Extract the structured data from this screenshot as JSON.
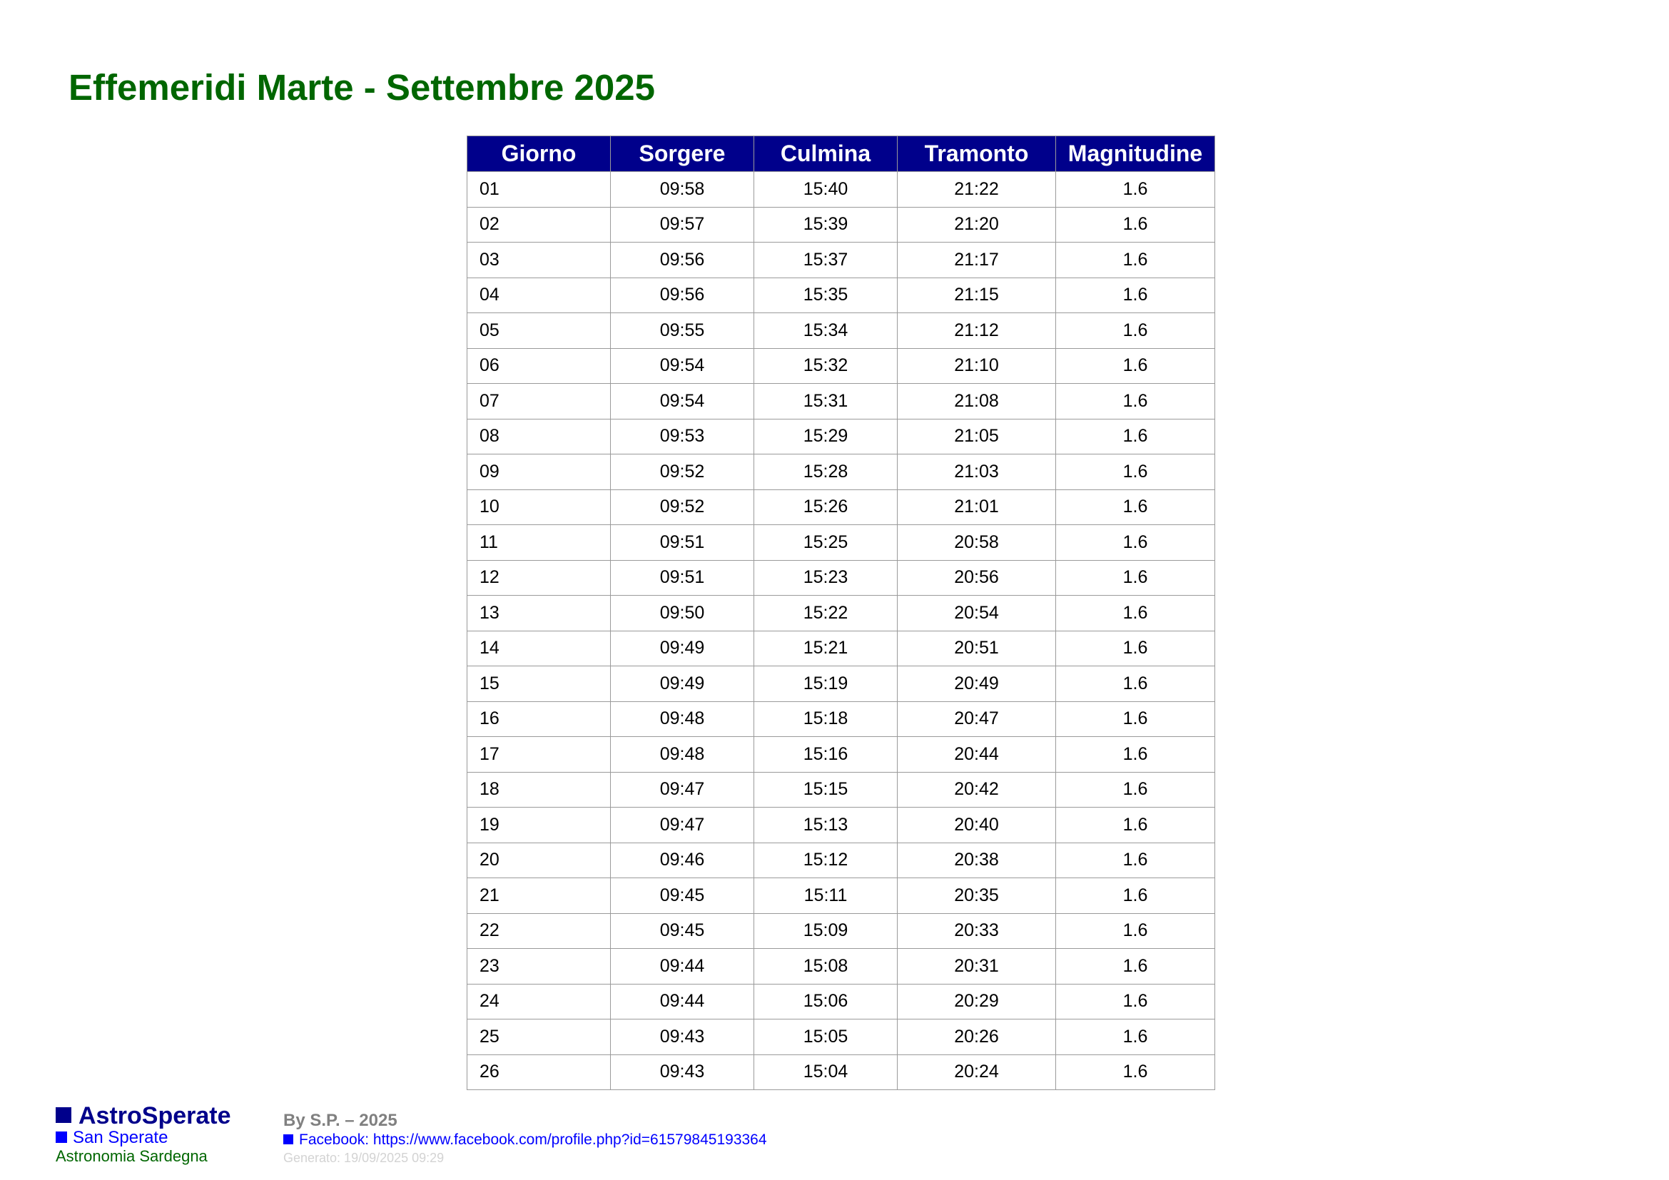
{
  "page": {
    "title": "Effemeridi Marte - Settembre 2025"
  },
  "table": {
    "columns": [
      "Giorno",
      "Sorgere",
      "Culmina",
      "Tramonto",
      "Magnitudine"
    ],
    "rows": [
      [
        "01",
        "09:58",
        "15:40",
        "21:22",
        "1.6"
      ],
      [
        "02",
        "09:57",
        "15:39",
        "21:20",
        "1.6"
      ],
      [
        "03",
        "09:56",
        "15:37",
        "21:17",
        "1.6"
      ],
      [
        "04",
        "09:56",
        "15:35",
        "21:15",
        "1.6"
      ],
      [
        "05",
        "09:55",
        "15:34",
        "21:12",
        "1.6"
      ],
      [
        "06",
        "09:54",
        "15:32",
        "21:10",
        "1.6"
      ],
      [
        "07",
        "09:54",
        "15:31",
        "21:08",
        "1.6"
      ],
      [
        "08",
        "09:53",
        "15:29",
        "21:05",
        "1.6"
      ],
      [
        "09",
        "09:52",
        "15:28",
        "21:03",
        "1.6"
      ],
      [
        "10",
        "09:52",
        "15:26",
        "21:01",
        "1.6"
      ],
      [
        "11",
        "09:51",
        "15:25",
        "20:58",
        "1.6"
      ],
      [
        "12",
        "09:51",
        "15:23",
        "20:56",
        "1.6"
      ],
      [
        "13",
        "09:50",
        "15:22",
        "20:54",
        "1.6"
      ],
      [
        "14",
        "09:49",
        "15:21",
        "20:51",
        "1.6"
      ],
      [
        "15",
        "09:49",
        "15:19",
        "20:49",
        "1.6"
      ],
      [
        "16",
        "09:48",
        "15:18",
        "20:47",
        "1.6"
      ],
      [
        "17",
        "09:48",
        "15:16",
        "20:44",
        "1.6"
      ],
      [
        "18",
        "09:47",
        "15:15",
        "20:42",
        "1.6"
      ],
      [
        "19",
        "09:47",
        "15:13",
        "20:40",
        "1.6"
      ],
      [
        "20",
        "09:46",
        "15:12",
        "20:38",
        "1.6"
      ],
      [
        "21",
        "09:45",
        "15:11",
        "20:35",
        "1.6"
      ],
      [
        "22",
        "09:45",
        "15:09",
        "20:33",
        "1.6"
      ],
      [
        "23",
        "09:44",
        "15:08",
        "20:31",
        "1.6"
      ],
      [
        "24",
        "09:44",
        "15:06",
        "20:29",
        "1.6"
      ],
      [
        "25",
        "09:43",
        "15:05",
        "20:26",
        "1.6"
      ],
      [
        "26",
        "09:43",
        "15:04",
        "20:24",
        "1.6"
      ]
    ]
  },
  "footer": {
    "brand": {
      "name": "AstroSperate",
      "place": "San Sperate",
      "tagline": "Astronomia Sardegna"
    },
    "author": "By S.P. – 2025",
    "facebook_link": "Facebook: https://www.facebook.com/profile.php?id=61579845193364",
    "generated": "Generato: 19/09/2025 09:29"
  },
  "colors": {
    "title": "#006600",
    "header_bg": "#00008b",
    "header_text": "#ffffff",
    "border": "#9a9a9a",
    "brand": "#00008b",
    "link": "#0000ff",
    "author": "#808080",
    "generated": "#d3d3d3"
  },
  "icons": {
    "brand_marker": "blue-square-icon",
    "place_marker": "blue-square-icon",
    "link_marker": "blue-square-icon"
  }
}
